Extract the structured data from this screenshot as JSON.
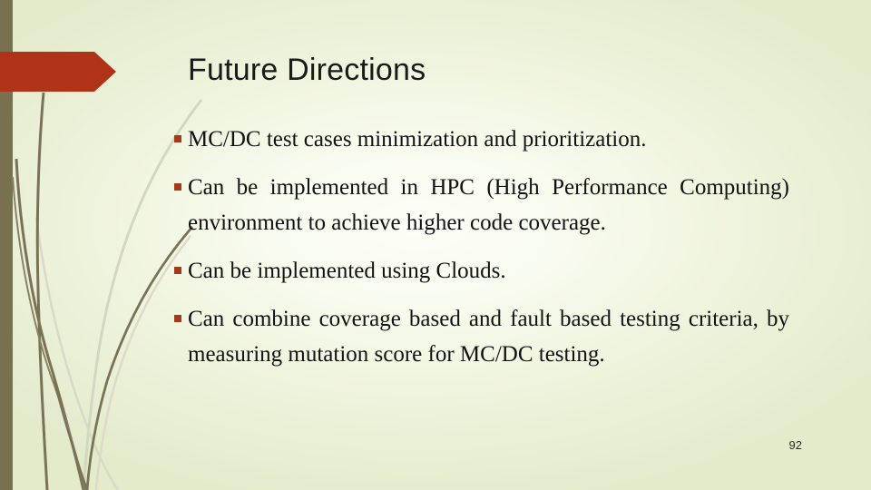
{
  "slide": {
    "title": "Future Directions",
    "page_number": "92",
    "bullet_glyph": "▪",
    "colors": {
      "background_light": "#f8fbee",
      "background_green": "#e3ebcb",
      "left_stripe": "#78704f",
      "arrow_red": "#b03217",
      "bullet_red": "#a33a1c",
      "reed_dark": "#7a7256",
      "reed_light": "#cfd3bc",
      "text": "#121212"
    },
    "bullets": [
      {
        "text": "MC/DC test cases minimization and prioritization.",
        "justified": false
      },
      {
        "text": "Can be implemented in HPC (High Performance Computing) environment to achieve higher code coverage.",
        "justified": true
      },
      {
        "text": "Can be implemented  using Clouds.",
        "justified": false
      },
      {
        "text": "Can combine coverage based and fault based testing criteria, by measuring  mutation score for MC/DC testing.",
        "justified": true
      }
    ]
  }
}
